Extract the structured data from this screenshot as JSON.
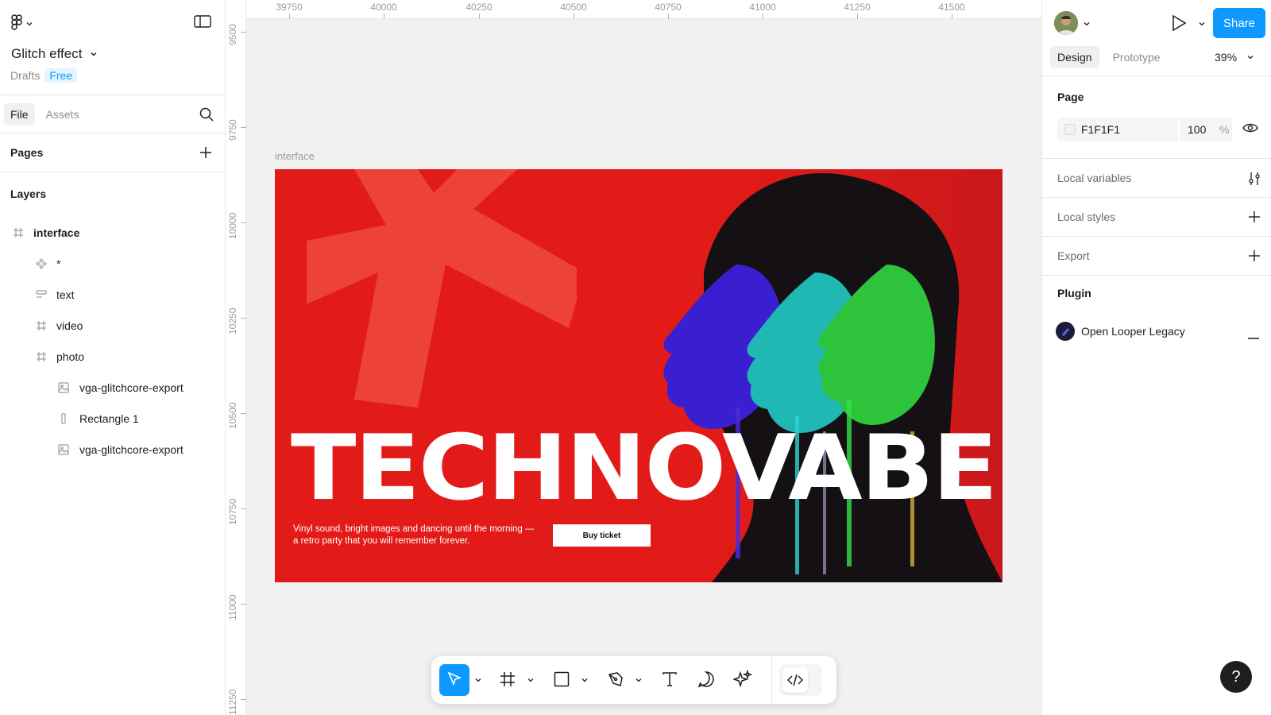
{
  "file": {
    "name": "Glitch effect",
    "location": "Drafts",
    "plan": "Free"
  },
  "left_tabs": {
    "file": "File",
    "assets": "Assets"
  },
  "pages": {
    "title": "Pages"
  },
  "layers": {
    "title": "Layers",
    "items": [
      {
        "name": "interface",
        "icon": "frame-icon",
        "level": 0
      },
      {
        "name": "*",
        "icon": "component-icon",
        "level": 1
      },
      {
        "name": "text",
        "icon": "autolayout-icon",
        "level": 1
      },
      {
        "name": "video",
        "icon": "frame-icon",
        "level": 1
      },
      {
        "name": "photo",
        "icon": "frame-icon",
        "level": 1
      },
      {
        "name": "vga-glitchcore-export",
        "icon": "image-icon",
        "level": 2
      },
      {
        "name": "Rectangle 1",
        "icon": "rectangle-icon",
        "level": 2
      },
      {
        "name": "vga-glitchcore-export",
        "icon": "image-icon",
        "level": 2
      }
    ]
  },
  "ruler": {
    "top": [
      "39750",
      "40000",
      "40250",
      "40500",
      "40750",
      "41000",
      "41250",
      "41500"
    ],
    "left": [
      "9500",
      "9750",
      "10000",
      "10250",
      "10500",
      "10750",
      "11000",
      "11250"
    ]
  },
  "canvas": {
    "frame_label": "interface",
    "headline": "TECHNOVABE",
    "description": "Vinyl sound, bright images and dancing until the morning — a retro party that you will remember forever.",
    "button": "Buy ticket",
    "colors": {
      "background": "#e31b18",
      "canvas": "#f1f1f1"
    }
  },
  "toolbar": {
    "tools": [
      "move-tool",
      "frame-tool",
      "rectangle-tool",
      "pen-tool",
      "text-tool",
      "comment-tool",
      "actions-tool",
      "dev-mode-toggle"
    ],
    "active": "move-tool",
    "accent": "#0d99ff"
  },
  "right_panel": {
    "share": "Share",
    "tabs": {
      "design": "Design",
      "prototype": "Prototype"
    },
    "zoom": "39%",
    "page": {
      "title": "Page",
      "fill_hex": "F1F1F1",
      "opacity": "100",
      "opacity_unit": "%"
    },
    "local_variables": "Local variables",
    "local_styles": "Local styles",
    "export": "Export",
    "plugin": {
      "title": "Plugin",
      "name": "Open Looper Legacy"
    },
    "help": "?"
  }
}
